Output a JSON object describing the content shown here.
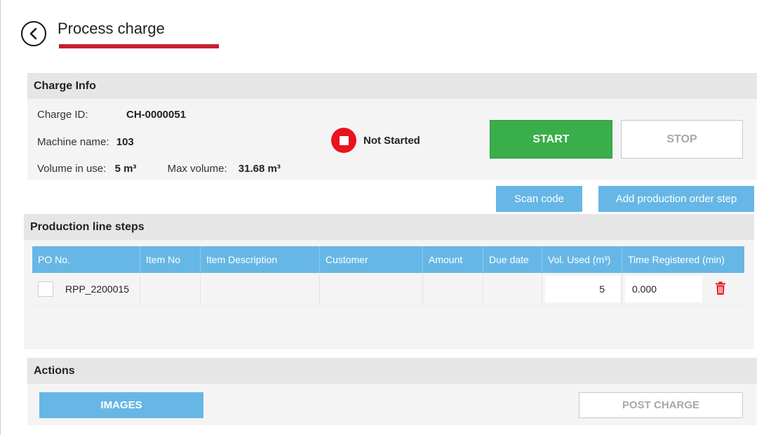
{
  "header": {
    "title": "Process charge"
  },
  "charge_info": {
    "heading": "Charge Info",
    "charge_id_label": "Charge ID:",
    "charge_id_value": "CH-0000051",
    "machine_label": "Machine name:",
    "machine_value": "103",
    "volume_label": "Volume in use:",
    "volume_value": "5 m³",
    "max_volume_label": "Max volume:",
    "max_volume_value": "31.68 m³",
    "status_text": "Not Started",
    "start_label": "START",
    "stop_label": "STOP"
  },
  "toolbar": {
    "scan_label": "Scan code",
    "add_step_label": "Add production order step"
  },
  "steps": {
    "heading": "Production line steps",
    "columns": [
      "PO No.",
      "Item No",
      "Item Description",
      "Customer",
      "Amount",
      "Due date",
      "Vol. Used (m³)",
      "Time Registered (min)"
    ],
    "rows": [
      {
        "po_no": "RPP_2200015",
        "item_no": "",
        "item_desc": "",
        "customer": "",
        "amount": "",
        "due_date": "",
        "vol_used": "5",
        "time_registered": "0.000"
      }
    ]
  },
  "actions": {
    "heading": "Actions",
    "images_label": "IMAGES",
    "post_label": "POST CHARGE"
  },
  "colors": {
    "accent_red": "#c8202f",
    "status_red": "#e8141e",
    "start_green": "#3aae4a",
    "primary_blue": "#66b7e6"
  },
  "icons": {
    "back": "chevron-left-icon",
    "status": "stop-icon",
    "delete": "trash-icon"
  }
}
